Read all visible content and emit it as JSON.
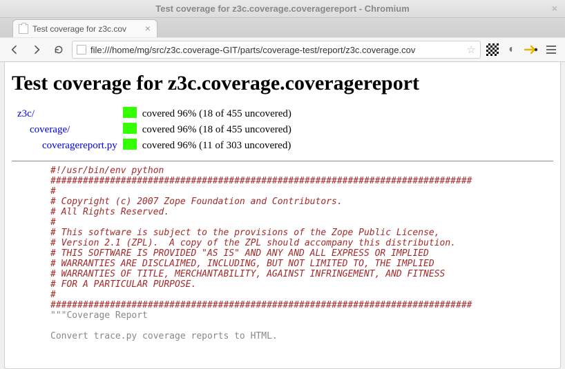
{
  "window": {
    "title": "Test coverage for z3c.coverage.coveragereport - Chromium"
  },
  "tab": {
    "title": "Test coverage for z3c.cov"
  },
  "url": "file:///home/mg/src/z3c.coverage-GIT/parts/coverage-test/report/z3c.coverage.cov",
  "page": {
    "heading": "Test coverage for z3c.coverage.coveragereport",
    "rows": [
      {
        "indent": 0,
        "name": "z3c/",
        "stats": "covered 96% (18 of 455 uncovered)"
      },
      {
        "indent": 1,
        "name": "coverage/",
        "stats": "covered 96% (18 of 455 uncovered)"
      },
      {
        "indent": 2,
        "name": "coveragereport.py",
        "stats": "covered 96% (11 of 303 uncovered)"
      }
    ]
  },
  "src": {
    "l01": "#!/usr/bin/env python",
    "l02": "##############################################################################",
    "l03": "#",
    "l04": "# Copyright (c) 2007 Zope Foundation and Contributors.",
    "l05": "# All Rights Reserved.",
    "l06": "#",
    "l07": "# This software is subject to the provisions of the Zope Public License,",
    "l08": "# Version 2.1 (ZPL).  A copy of the ZPL should accompany this distribution.",
    "l09": "# THIS SOFTWARE IS PROVIDED \"AS IS\" AND ANY AND ALL EXPRESS OR IMPLIED",
    "l10": "# WARRANTIES ARE DISCLAIMED, INCLUDING, BUT NOT LIMITED TO, THE IMPLIED",
    "l11": "# WARRANTIES OF TITLE, MERCHANTABILITY, AGAINST INFRINGEMENT, AND FITNESS",
    "l12": "# FOR A PARTICULAR PURPOSE.",
    "l13": "#",
    "l14": "##############################################################################",
    "l15": "\"\"\"Coverage Report",
    "l16": "",
    "l17": "Convert trace.py coverage reports to HTML."
  }
}
